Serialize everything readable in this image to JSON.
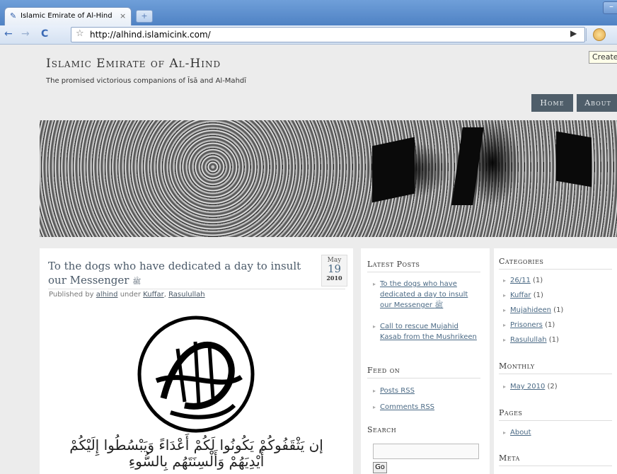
{
  "browser": {
    "tab_title": "Islamic Emirate of Al-Hind",
    "tab_close": "×",
    "new_tab": "+",
    "url": "http://alhind.islamicink.com/",
    "tooltip": "Create"
  },
  "site": {
    "title": "Islamic Emirate of Al-Hind",
    "description": "The promised victorious companions of Īsā and Al-Mahdī",
    "nav": [
      "Home",
      "About"
    ]
  },
  "post": {
    "title": "To the dogs who have dedicated a day to insult our Messenger",
    "title_honorific": "ﷺ",
    "date": {
      "month": "May",
      "day": "19",
      "year": "2010"
    },
    "meta_prefix": "Published by",
    "author": "alhind",
    "meta_under": "under",
    "categories": [
      "Kuffar",
      "Rasulullah"
    ],
    "arabic_line1": "إن يَثْقَفُوكُمْ يَكُونُوا لَكُمْ أَعْدَاءً وَيَبْسُطُوا إِلَيْكُمْ",
    "arabic_line2": "أَيْدِيَهُمْ وَأَلْسِنَتَهُم بِالسُّوءِ"
  },
  "sidebar_mid": {
    "latest_posts_head": "Latest Posts",
    "latest_posts": [
      {
        "text": "To the dogs who have dedicated a day to insult our Messenger ﷺ"
      },
      {
        "text": "Call to rescue Mujahid Kasab from the Mushrikeen"
      }
    ],
    "feed_head": "Feed on",
    "feeds": [
      "Posts RSS",
      "Comments RSS"
    ],
    "search_head": "Search",
    "search_button": "Go"
  },
  "sidebar_right": {
    "categories_head": "Categories",
    "categories": [
      {
        "name": "26/11",
        "count": "(1)"
      },
      {
        "name": "Kuffar",
        "count": "(1)"
      },
      {
        "name": "Mujahideen",
        "count": "(1)"
      },
      {
        "name": "Prisoners",
        "count": "(1)"
      },
      {
        "name": "Rasulullah",
        "count": "(1)"
      }
    ],
    "monthly_head": "Monthly",
    "monthly": [
      {
        "name": "May 2010",
        "count": "(2)"
      }
    ],
    "pages_head": "Pages",
    "pages": [
      "About"
    ],
    "meta_head": "Meta"
  },
  "colors": {
    "nav_bg": "#4f5e6a",
    "link": "#4b6a85",
    "title": "#4b5a69"
  }
}
